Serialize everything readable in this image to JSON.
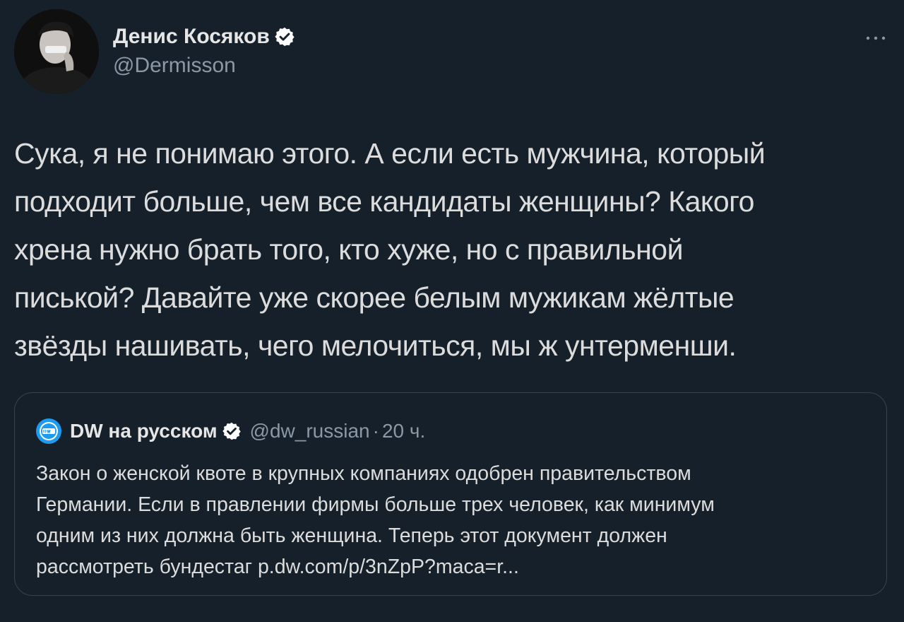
{
  "author": {
    "name": "Денис Косяков",
    "handle": "@Dermisson",
    "verified": true
  },
  "icons": {
    "verified": "verified-badge-icon",
    "more": "more-horizontal-icon",
    "quote_logo": "dw-logo-icon"
  },
  "tweet": {
    "text": "Сука, я не понимаю этого. А если есть мужчина, который\nподходит больше, чем все кандидаты женщины? Какого\nхрена нужно брать того, кто хуже, но с правильной\nписькой? Давайте уже скорее белым мужикам жёлтые\nзвёзды нашивать, чего мелочиться, мы ж унтерменши."
  },
  "quote": {
    "name": "DW на русском",
    "handle": "@dw_russian",
    "separator": "·",
    "time": "20 ч.",
    "text": "Закон о женской квоте в крупных компаниях одобрен правительством\nГермании. Если в правлении фирмы больше трех человек, как минимум\nодним из них должна быть женщина. Теперь этот документ должен\nрассмотреть бундестаг p.dw.com/p/3nZpP?maca=r..."
  },
  "colors": {
    "background": "#15202b",
    "border": "#38444d",
    "secondary_text": "#8b98a5",
    "accent": "#1d9bf0"
  }
}
